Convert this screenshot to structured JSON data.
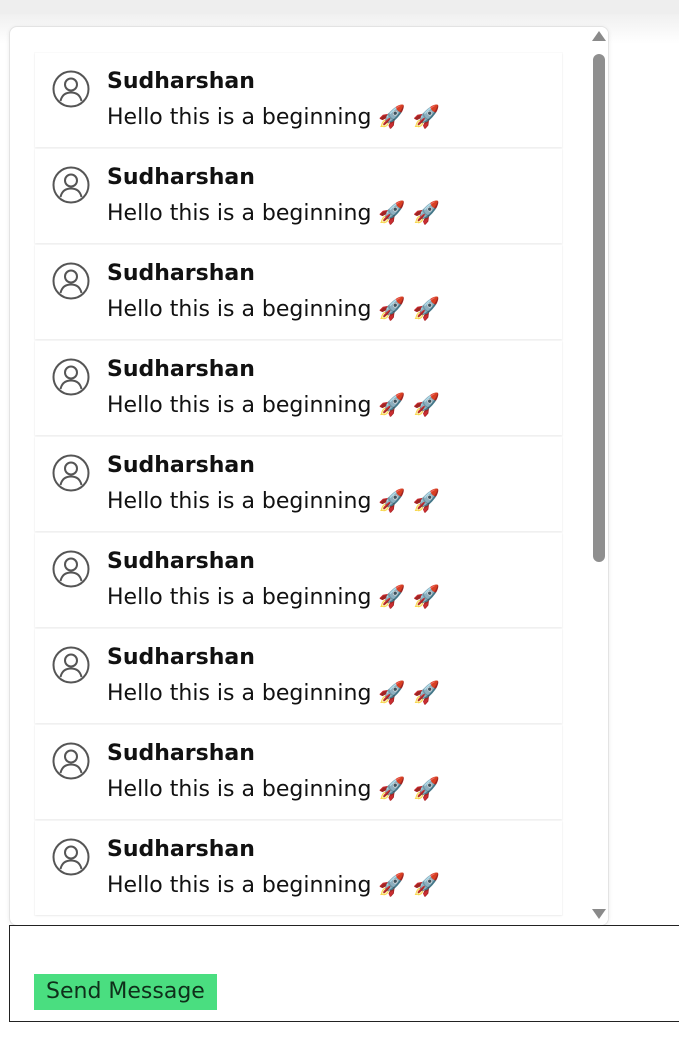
{
  "messages": [
    {
      "sender": "Sudharshan",
      "text": "Hello this is a beginning 🚀 🚀",
      "avatar_icon": "user-circle-icon"
    },
    {
      "sender": "Sudharshan",
      "text": "Hello this is a beginning 🚀 🚀",
      "avatar_icon": "user-circle-icon"
    },
    {
      "sender": "Sudharshan",
      "text": "Hello this is a beginning 🚀 🚀",
      "avatar_icon": "user-circle-icon"
    },
    {
      "sender": "Sudharshan",
      "text": "Hello this is a beginning 🚀 🚀",
      "avatar_icon": "user-circle-icon"
    },
    {
      "sender": "Sudharshan",
      "text": "Hello this is a beginning 🚀 🚀",
      "avatar_icon": "user-circle-icon"
    },
    {
      "sender": "Sudharshan",
      "text": "Hello this is a beginning 🚀 🚀",
      "avatar_icon": "user-circle-icon"
    },
    {
      "sender": "Sudharshan",
      "text": "Hello this is a beginning 🚀 🚀",
      "avatar_icon": "user-circle-icon"
    },
    {
      "sender": "Sudharshan",
      "text": "Hello this is a beginning 🚀 🚀",
      "avatar_icon": "user-circle-icon"
    },
    {
      "sender": "Sudharshan",
      "text": "Hello this is a beginning 🚀 🚀",
      "avatar_icon": "user-circle-icon"
    }
  ],
  "composer": {
    "input_value": "",
    "send_label": "Send Message"
  },
  "colors": {
    "send_button_bg": "#4ade80",
    "scrollbar_thumb": "#8f8f8f",
    "text": "#111111"
  }
}
